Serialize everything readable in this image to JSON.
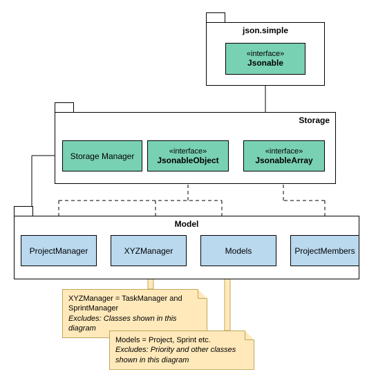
{
  "packages": {
    "json_simple": {
      "name": "json.simple"
    },
    "storage": {
      "name": "Storage"
    },
    "model": {
      "name": "Model"
    }
  },
  "classes": {
    "jsonable": {
      "stereotype": "«interface»",
      "name": "Jsonable"
    },
    "storage_manager": {
      "name": "Storage Manager"
    },
    "jsonable_object": {
      "stereotype": "«interface»",
      "name": "JsonableObject"
    },
    "jsonable_array": {
      "stereotype": "«interface»",
      "name": "JsonableArray"
    },
    "project_manager": {
      "name": "ProjectManager"
    },
    "xyz_manager": {
      "name": "XYZManager"
    },
    "models": {
      "name": "Models"
    },
    "project_members": {
      "name": "ProjectMembers"
    }
  },
  "notes": {
    "xyz": {
      "line1": "XYZManager = TaskManager and",
      "line2": "SprintManager",
      "excludes": "Excludes: Classes shown in this diagram"
    },
    "models": {
      "line1": "Models = Project, Sprint etc.",
      "excludes1": "Excludes: Priority and other classes",
      "excludes2": "shown in this diagram"
    }
  }
}
